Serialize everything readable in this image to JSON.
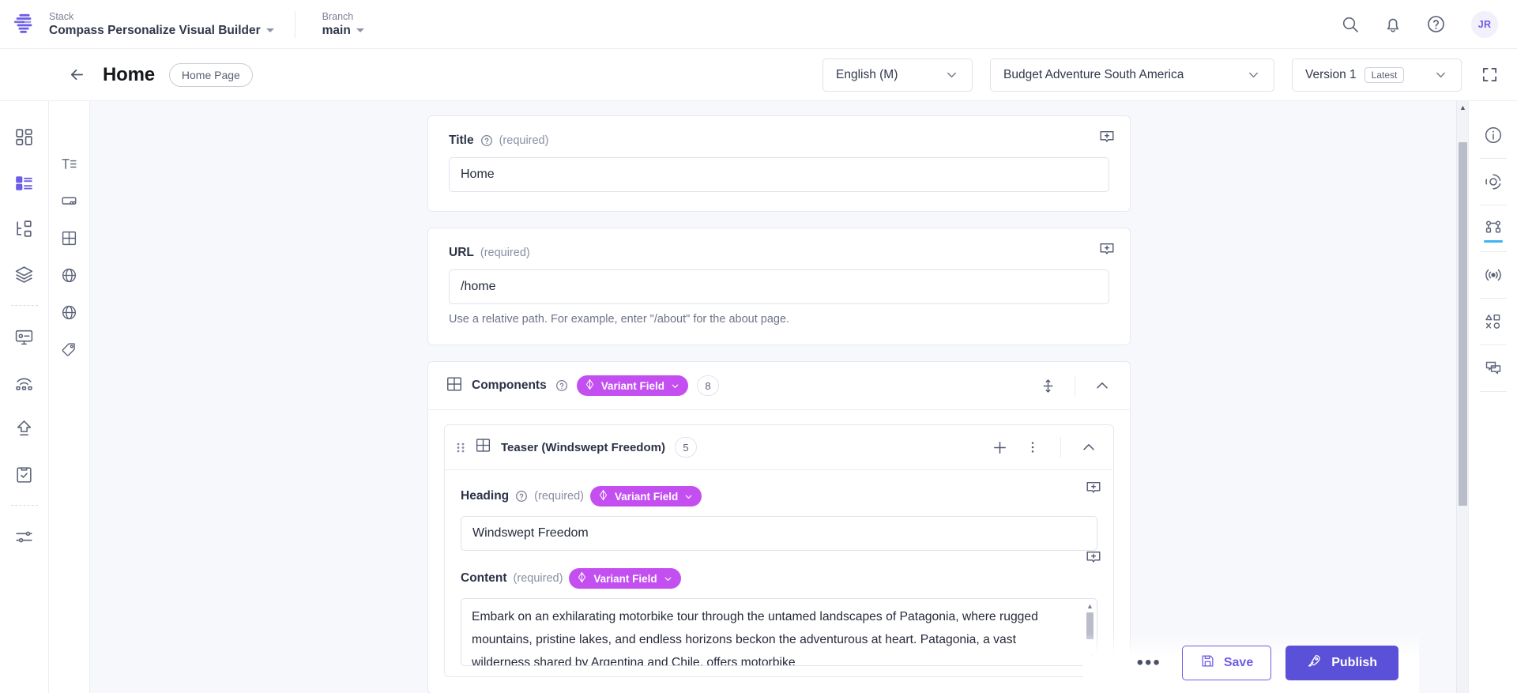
{
  "header": {
    "logo_icon": "contentstack-logo-icon",
    "stack": {
      "label": "Stack",
      "value": "Compass Personalize Visual Builder"
    },
    "branch": {
      "label": "Branch",
      "value": "main"
    },
    "icons": [
      "search-icon",
      "notification-bell-icon",
      "help-circle-icon"
    ],
    "avatar_initials": "JR"
  },
  "subheader": {
    "back_icon": "back-arrow-icon",
    "title": "Home",
    "content_type_badge": "Home Page",
    "locale_dropdown": "English (M)",
    "environment_dropdown": "Budget Adventure South America",
    "version_dropdown": "Version 1",
    "version_badge": "Latest",
    "fullscreen_icon": "expand-fullscreen-icon"
  },
  "left_rail": {
    "items": [
      {
        "name": "dashboard-icon",
        "active": false
      },
      {
        "name": "entries-icon",
        "active": true
      },
      {
        "name": "content-model-icon",
        "active": false
      },
      {
        "name": "stacks-layers-icon",
        "active": false
      },
      {
        "name": "divider",
        "active": false
      },
      {
        "name": "live-preview-monitor-icon",
        "active": false
      },
      {
        "name": "releases-broadcast-icon",
        "active": false
      },
      {
        "name": "publish-upload-icon",
        "active": false
      },
      {
        "name": "tasks-clipboard-icon",
        "active": false
      },
      {
        "name": "divider",
        "active": false
      },
      {
        "name": "settings-sliders-icon",
        "active": false
      }
    ]
  },
  "second_rail": {
    "items": [
      "text-format-icon",
      "url-link-icon",
      "components-grid-icon",
      "globe-seo-icon",
      "globe-locale-icon",
      "tag-icon"
    ]
  },
  "right_rail": {
    "items": [
      {
        "name": "info-circle-icon",
        "active": false
      },
      {
        "name": "target-focus-icon",
        "active": false
      },
      {
        "name": "variants-graph-icon",
        "active": true
      },
      {
        "name": "broadcast-signal-icon",
        "active": false
      },
      {
        "name": "shapes-icon",
        "active": false
      },
      {
        "name": "comments-icon",
        "active": false
      }
    ]
  },
  "form": {
    "title_field": {
      "label": "Title",
      "required_text": "(required)",
      "help_icon": "help-circle-icon",
      "comment_icon": "add-comment-icon",
      "value": "Home"
    },
    "url_field": {
      "label": "URL",
      "required_text": "(required)",
      "comment_icon": "add-comment-icon",
      "value": "/home",
      "helper_text": "Use a relative path. For example, enter \"/about\" for the about page."
    },
    "components_group": {
      "icon": "grid-table-icon",
      "label": "Components",
      "help_icon": "help-circle-icon",
      "variant_badge": "Variant Field",
      "variant_icon": "variant-diamond-icon",
      "count": "8",
      "reorder_icon": "move-vertical-icon",
      "collapse_icon": "chevron-up-icon"
    },
    "teaser_block": {
      "drag_icon": "drag-handle-icon",
      "grid_icon": "grid-table-icon",
      "title": "Teaser (Windswept Freedom)",
      "count": "5",
      "add_icon": "plus-icon",
      "more_icon": "kebab-menu-icon",
      "collapse_icon": "chevron-up-icon",
      "heading_field": {
        "label": "Heading",
        "required_text": "(required)",
        "help_icon": "help-circle-icon",
        "variant_badge": "Variant Field",
        "variant_icon": "variant-diamond-icon",
        "comment_icon": "add-comment-icon",
        "value": "Windswept Freedom"
      },
      "content_field": {
        "label": "Content",
        "required_text": "(required)",
        "variant_badge": "Variant Field",
        "variant_icon": "variant-diamond-icon",
        "comment_icon": "add-comment-icon",
        "value": "Embark on an exhilarating motorbike tour through the untamed landscapes of Patagonia, where rugged mountains, pristine lakes, and endless horizons beckon the adventurous at heart. Patagonia, a vast wilderness shared by Argentina and Chile, offers motorbike"
      }
    }
  },
  "actions": {
    "more_label": "•••",
    "save_label": "Save",
    "save_icon": "save-floppy-icon",
    "publish_label": "Publish",
    "publish_icon": "rocket-icon"
  },
  "colors": {
    "accent_purple": "#5b51d8",
    "variant_magenta": "#c34ff0",
    "active_blue": "#3ab6f0",
    "canvas": "#f7f8fc"
  }
}
